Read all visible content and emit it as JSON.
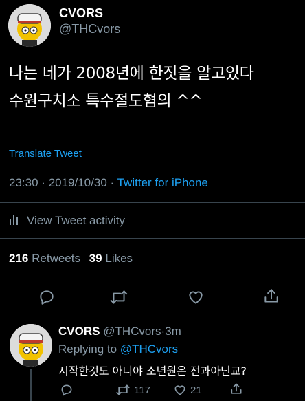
{
  "tweet": {
    "author_name": "CVORS",
    "author_handle": "@THCvors",
    "text_line1": "나는 네가 2008년에 한짓을 알고있다",
    "text_line2": "수원구치소 특수절도혐의 ^^",
    "translate_label": "Translate Tweet",
    "time": "23:30",
    "date": "2019/10/30",
    "source": "Twitter for iPhone",
    "separator": "·",
    "activity_label": "View Tweet activity",
    "retweets_count": "216",
    "retweets_label": "Retweets",
    "likes_count": "39",
    "likes_label": "Likes"
  },
  "reply": {
    "author_name": "CVORS",
    "author_handle": "@THCvors",
    "age": "3m",
    "separator": "·",
    "replying_to_prefix": "Replying to",
    "replying_to_handle": "@THCvors",
    "text": "시작한것도 아니야 소년원은 전과아닌교?",
    "retweet_count": "117",
    "like_count": "21"
  },
  "icons": {
    "reply": "reply-icon",
    "retweet": "retweet-icon",
    "like": "heart-icon",
    "share": "share-icon",
    "activity": "bar-chart-icon"
  },
  "colors": {
    "background": "#000000",
    "text": "#ffffff",
    "muted": "#8899a6",
    "link": "#1da1f2",
    "divider": "#38444d"
  }
}
